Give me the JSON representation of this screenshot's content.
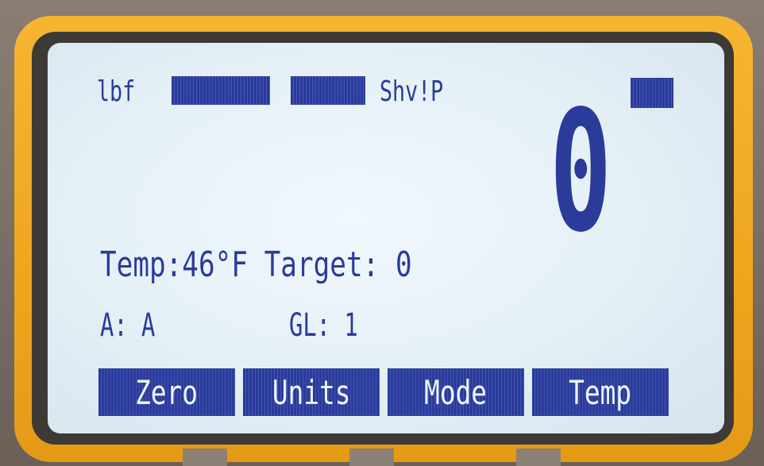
{
  "status": {
    "unit": "lbf",
    "mode": "Shv!P"
  },
  "display": {
    "reading": "0"
  },
  "info": {
    "temp_label": "Temp:46°F",
    "target_label": "Target: 0",
    "a_label": "A: A",
    "gl_label": "GL: 1"
  },
  "softkeys": [
    "Zero",
    "Units",
    "Mode",
    "Temp"
  ],
  "colors": {
    "lcd_ink": "#2b3b9a",
    "lcd_background": "#e8f2f8",
    "bezel": "#f2ad28"
  },
  "icons": {
    "battery": "battery-icon",
    "status_block_1": "status-block-icon",
    "status_block_2": "status-block-icon"
  }
}
